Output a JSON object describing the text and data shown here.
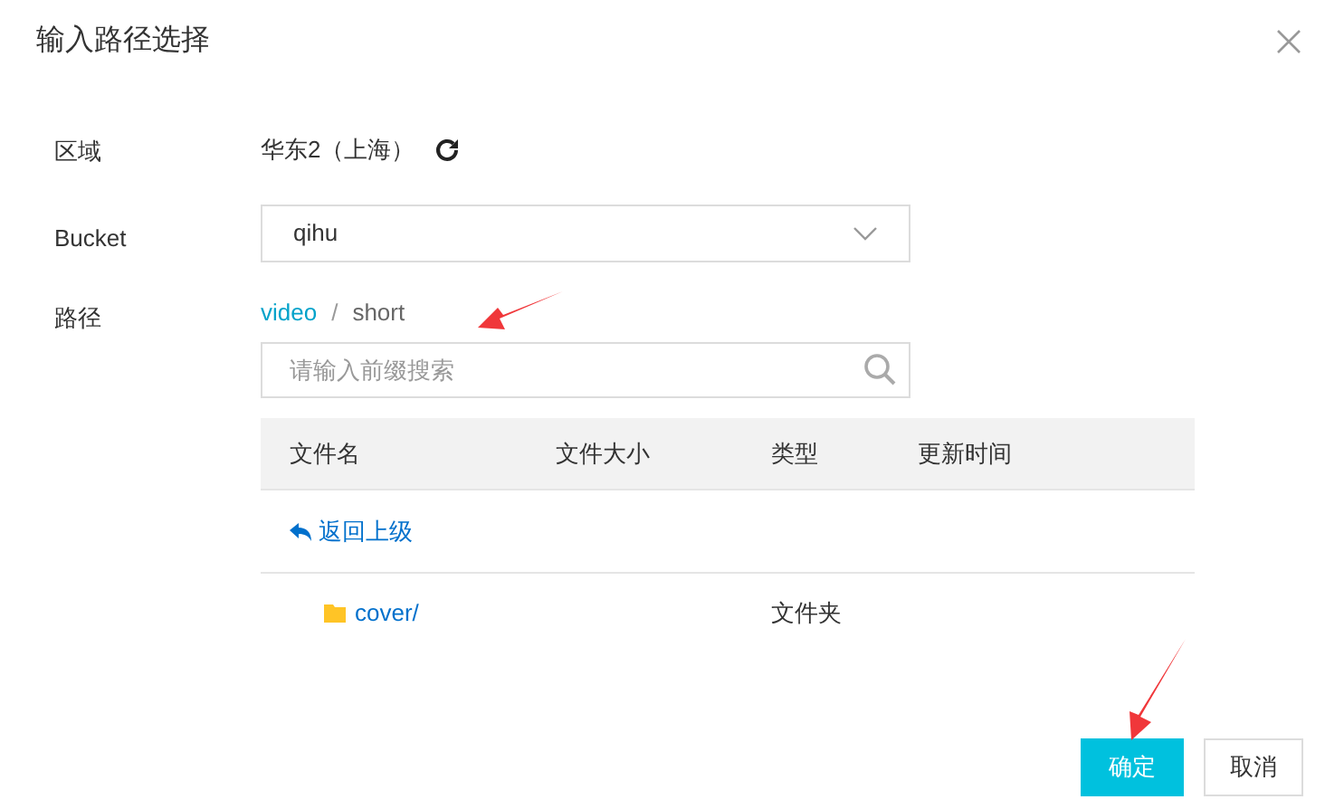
{
  "dialog": {
    "title": "输入路径选择"
  },
  "fields": [
    {
      "kind": "region",
      "label": "区域",
      "value": "华东2（上海）"
    },
    {
      "kind": "select",
      "label": "Bucket",
      "value": "qihu"
    },
    {
      "kind": "path",
      "label": "路径",
      "separator": "/",
      "crumbs": [
        {
          "label": "video",
          "current": false
        },
        {
          "label": "short",
          "current": true
        }
      ],
      "placeholder": "请输入前缀搜索"
    }
  ],
  "table": {
    "columns": [
      "文件名",
      "文件大小",
      "类型",
      "更新时间"
    ],
    "rows": [
      {
        "kind": "back",
        "label": "返回上级"
      },
      {
        "kind": "folder",
        "name": "cover/",
        "type": "文件夹"
      }
    ]
  },
  "buttons": [
    {
      "label": "确定",
      "primary": true
    },
    {
      "label": "取消",
      "primary": false
    }
  ]
}
